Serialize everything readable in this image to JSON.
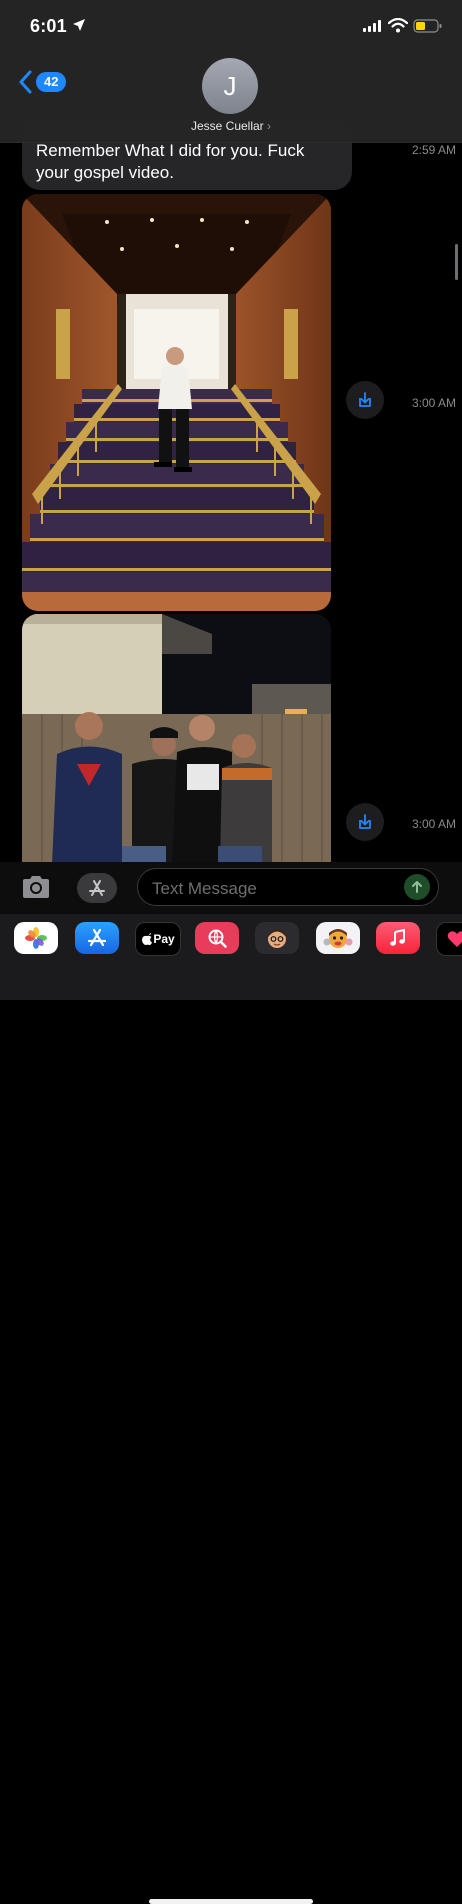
{
  "status_bar": {
    "time": "6:01"
  },
  "header": {
    "back_count": "42",
    "avatar_initial": "J",
    "contact_name": "Jesse Cuellar",
    "name_chevron": "›"
  },
  "messages": [
    {
      "type": "text",
      "text": "Remember What I did for you. Fuck your gospel video.",
      "timestamp": "2:59 AM"
    },
    {
      "type": "photo",
      "timestamp": "3:00 AM"
    },
    {
      "type": "photo",
      "timestamp": "3:00 AM"
    }
  ],
  "compose": {
    "placeholder": "Text Message"
  },
  "app_drawer": {
    "apple_pay_label": "Pay",
    "icons": [
      "photos-icon",
      "app-store-icon",
      "apple-pay-icon",
      "images-search-icon",
      "memoji-icon",
      "animoji-icon",
      "music-icon",
      "digital-touch-icon"
    ]
  }
}
